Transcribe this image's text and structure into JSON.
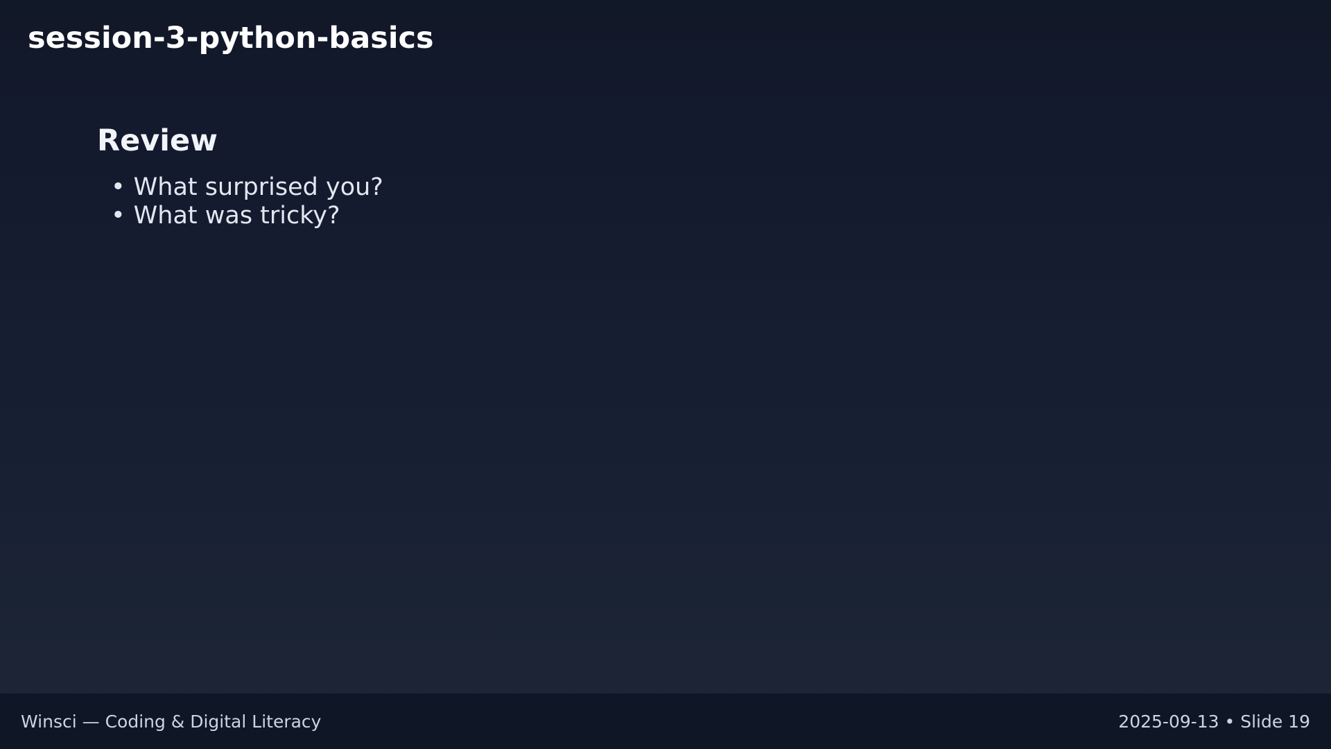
{
  "deck": {
    "title": "session-3-python-basics"
  },
  "slide": {
    "heading": "Review",
    "bullets": [
      "What surprised you?",
      "What was tricky?"
    ]
  },
  "footer": {
    "left": "Winsci — Coding & Digital Literacy",
    "right": "2025-09-13 • Slide 19"
  },
  "colors": {
    "background_top": "#111827",
    "background_bottom": "#1e2636",
    "footer_background": "#0f1626",
    "text_primary": "#ffffff",
    "text_secondary": "#cbd5e1"
  }
}
